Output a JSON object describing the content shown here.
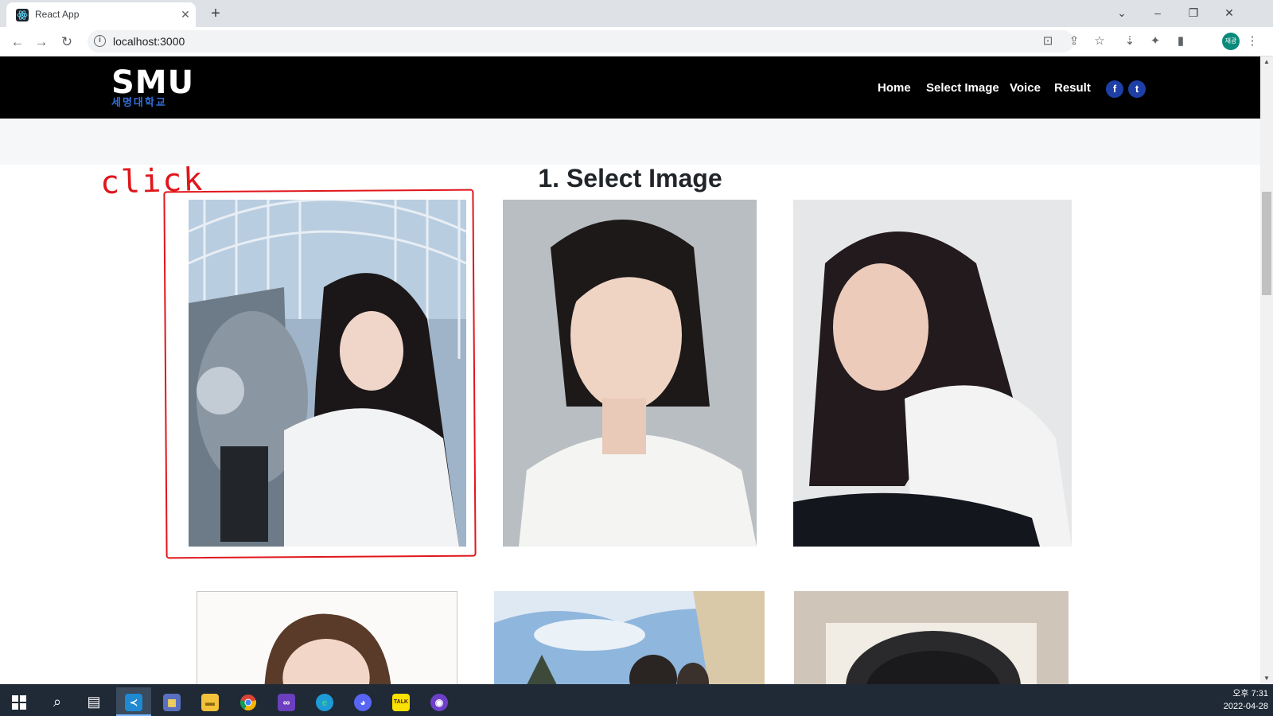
{
  "browser": {
    "tab_title": "React App",
    "tab_close": "✕",
    "new_tab": "+",
    "url": "localhost:3000",
    "window_controls": {
      "dropdown": "⌄",
      "minimize": "–",
      "restore": "❐",
      "close": "✕"
    },
    "profile_initials": "재광",
    "toolbar_icons": [
      "translate-icon",
      "share-icon",
      "bookmark-star-icon",
      "extension-pin-icon",
      "puzzle-extensions-icon",
      "side-panel-icon",
      "more-vert-icon"
    ]
  },
  "site": {
    "logo_text": "SMU",
    "logo_subtext": "세명대학교",
    "nav": [
      {
        "label": "Home"
      },
      {
        "label": "Select Image"
      },
      {
        "label": "Voice"
      },
      {
        "label": "Result"
      }
    ],
    "social": [
      {
        "name": "facebook-icon",
        "glyph": "f"
      },
      {
        "name": "twitter-icon",
        "glyph": "t"
      }
    ]
  },
  "main": {
    "section_title": "1. Select Image",
    "annotation": "click",
    "photo_count": 6
  },
  "taskbar": {
    "time": "오후 7:31",
    "date": "2022-04-28"
  },
  "colors": {
    "header_bg": "#000000",
    "annotation_red": "#e0161c",
    "social_blue": "#1d3fa6",
    "taskbar_bg": "#1f2a36"
  }
}
